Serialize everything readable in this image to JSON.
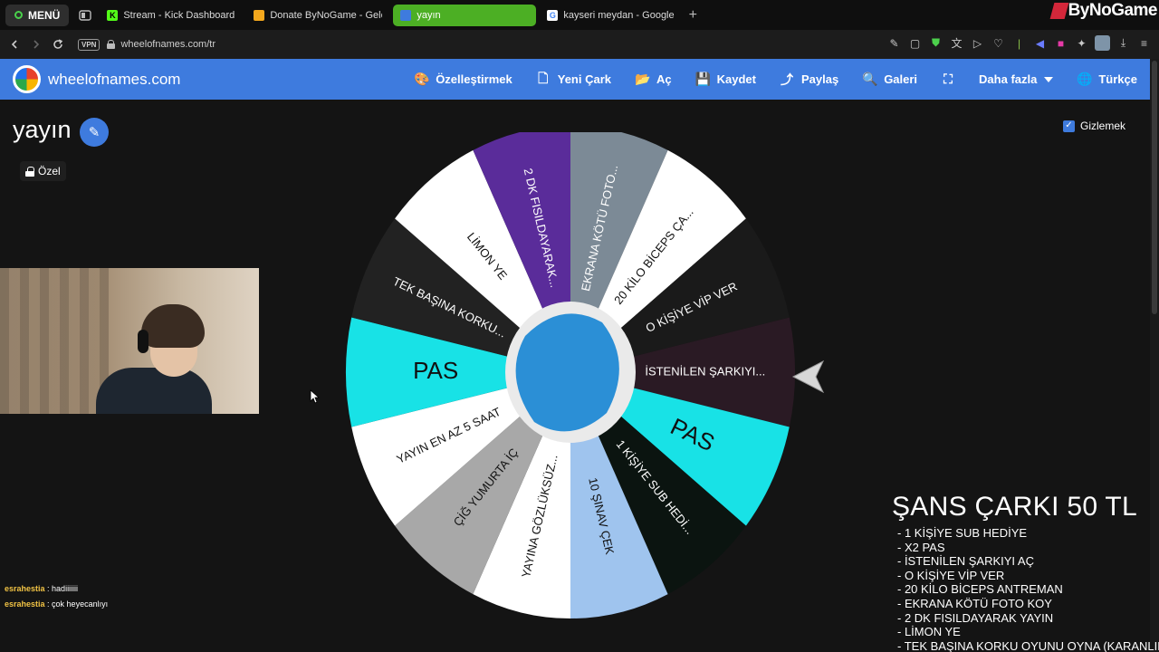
{
  "browser": {
    "menu_label": "MENÜ",
    "tabs": [
      {
        "label": "Stream - Kick Dashboard",
        "fav_color": "#53fc18",
        "fav_char": "K"
      },
      {
        "label": "Donate ByNoGame - Gele",
        "fav_color": "#f4a81d",
        "fav_char": ""
      },
      {
        "label": "yayın",
        "fav_color": "#3e7bde",
        "fav_char": "",
        "active": true
      },
      {
        "label": "kayseri meydan - Google",
        "fav_color": "#ffffff",
        "fav_char": "G"
      }
    ],
    "new_tab": "+",
    "overlay_logo": "ByNoGame",
    "vpn_label": "VPN",
    "url": "wheelofnames.com/tr"
  },
  "site": {
    "name": "wheelofnames.com",
    "menu": [
      {
        "label": "Özelleştirmek",
        "icon": "palette-icon",
        "glyph": "🎨"
      },
      {
        "label": "Yeni Çark",
        "icon": "document-icon",
        "glyph": "🗋"
      },
      {
        "label": "Aç",
        "icon": "folder-icon",
        "glyph": "📂"
      },
      {
        "label": "Kaydet",
        "icon": "save-icon",
        "glyph": "💾"
      },
      {
        "label": "Paylaş",
        "icon": "share-icon",
        "glyph": "⤴"
      },
      {
        "label": "Galeri",
        "icon": "search-icon",
        "glyph": "🔍"
      },
      {
        "label": "",
        "icon": "fullscreen-icon",
        "glyph": "⛶"
      },
      {
        "label": "Daha fazla",
        "icon": "more-icon",
        "glyph": ""
      },
      {
        "label": "Türkçe",
        "icon": "globe-icon",
        "glyph": "🌐"
      }
    ]
  },
  "wheel": {
    "title": "yayın",
    "private_label": "Özel",
    "hide_label": "Gizlemek",
    "segments": [
      {
        "text": "İSTENİLEN ŞARKIYI...",
        "bg": "#2a1a24",
        "fg": "#ffffff"
      },
      {
        "text": "PAS",
        "bg": "#18e2e6",
        "fg": "#111111"
      },
      {
        "text": "1 KİŞİYE SUB HEDİ...",
        "bg": "#0b1410",
        "fg": "#ffffff"
      },
      {
        "text": "10 ŞINAV ÇEK",
        "bg": "#9fc4ee",
        "fg": "#111111"
      },
      {
        "text": "YAYINA GÖZLÜKSÜZ...",
        "bg": "#ffffff",
        "fg": "#111111"
      },
      {
        "text": "ÇİĞ YUMURTA İÇ",
        "bg": "#a8a8a8",
        "fg": "#111111"
      },
      {
        "text": "YAYIN EN AZ 5 SAAT",
        "bg": "#ffffff",
        "fg": "#111111"
      },
      {
        "text": "PAS",
        "bg": "#18e2e6",
        "fg": "#111111"
      },
      {
        "text": "TEK BAŞINA KORKU...",
        "bg": "#222222",
        "fg": "#ffffff"
      },
      {
        "text": "LİMON YE",
        "bg": "#ffffff",
        "fg": "#111111"
      },
      {
        "text": "2 DK FISILDAYARAK...",
        "bg": "#5a2c9a",
        "fg": "#ffffff"
      },
      {
        "text": "EKRANA KÖTÜ FOTO...",
        "bg": "#7c8a96",
        "fg": "#ffffff"
      },
      {
        "text": "20 KİLO BİCEPS ÇA...",
        "bg": "#ffffff",
        "fg": "#111111"
      },
      {
        "text": "O KİŞİYE VİP VER",
        "bg": "#1a1a1a",
        "fg": "#ffffff"
      }
    ]
  },
  "chat": [
    {
      "user": "esrahestia",
      "sep": " : ",
      "msg": "hadiiiiiii"
    },
    {
      "user": "esrahestia",
      "sep": " : ",
      "msg": "çok heyecanlıyı"
    }
  ],
  "overlay": {
    "title": "ŞANS ÇARKI 50 TL",
    "items": [
      "- 1 KİŞİYE SUB HEDİYE",
      "-  X2 PAS",
      "- İSTENİLEN ŞARKIYI AÇ",
      "- O KİŞİYE VİP VER",
      "- 20 KİLO BİCEPS ANTREMAN",
      "- EKRANA KÖTÜ FOTO KOY",
      "- 2 DK FISILDAYARAK YAYIN",
      "- LİMON YE",
      "- TEK BAŞINA KORKU OYUNU OYNA (KARANLIK)"
    ]
  }
}
